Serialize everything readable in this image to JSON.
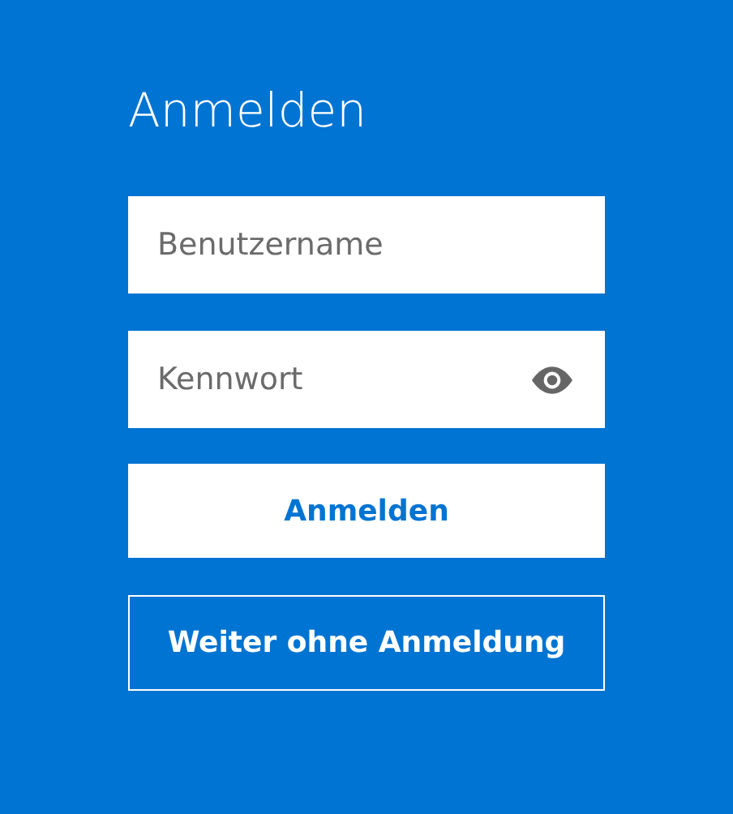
{
  "title": "Anmelden",
  "fields": [
    {
      "kind": "text",
      "placeholder": "Benutzername"
    },
    {
      "kind": "password",
      "placeholder": "Kennwort"
    }
  ],
  "buttons": [
    {
      "kind": "primary",
      "label": "Anmelden"
    },
    {
      "kind": "outline",
      "label": "Weiter ohne Anmeldung"
    }
  ]
}
